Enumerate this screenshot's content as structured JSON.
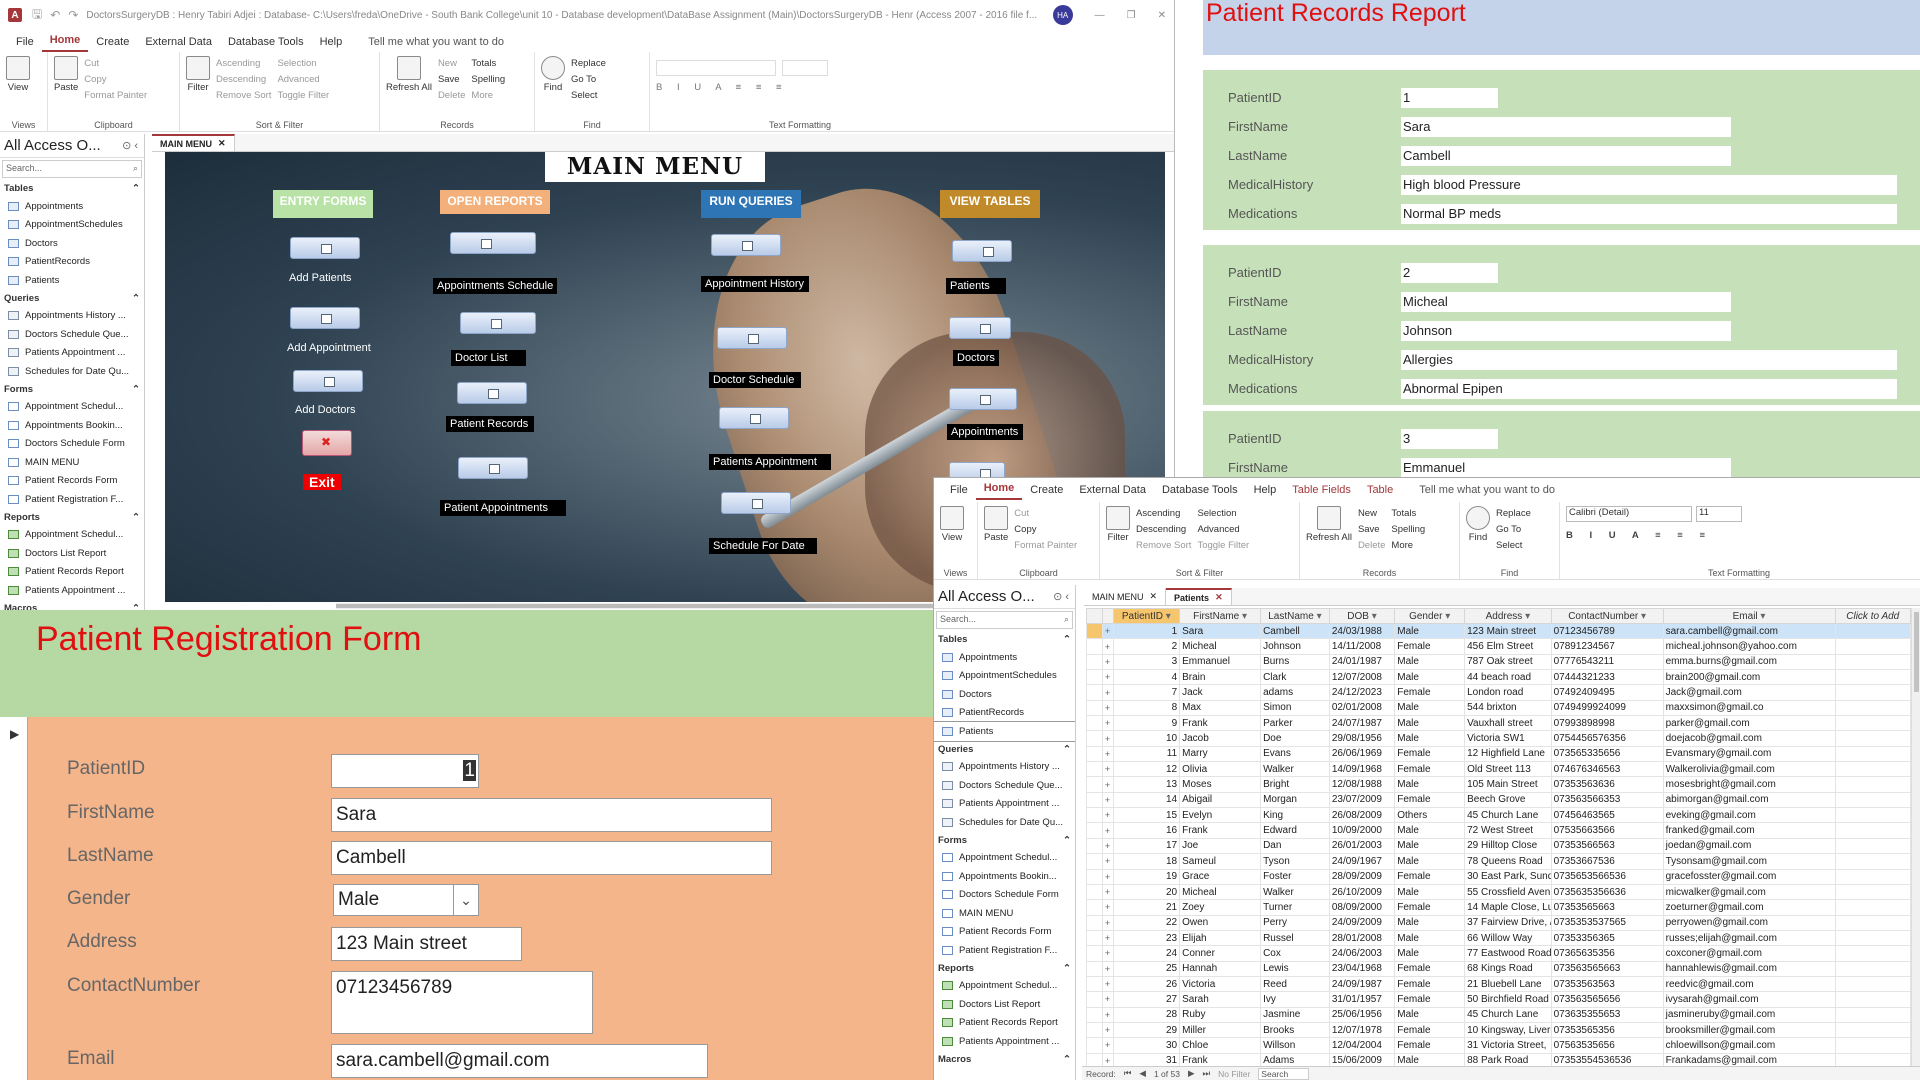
{
  "winA": {
    "title": "DoctorsSurgeryDB : Henry Tabiri Adjei : Database- C:\\Users\\freda\\OneDrive - South Bank College\\unit 10 - Database development\\DataBase Assignment (Main)\\DoctorsSurgeryDB - Henr (Access 2007 - 2016 file f...",
    "avatar": "HA",
    "menu": [
      "File",
      "Home",
      "Create",
      "External Data",
      "Database Tools",
      "Help"
    ],
    "tell_me": "Tell me what you want to do",
    "ribbon": {
      "view": "View",
      "paste": "Paste",
      "cut": "Cut",
      "copy": "Copy",
      "format_painter": "Format Painter",
      "filter": "Filter",
      "ascending": "Ascending",
      "descending": "Descending",
      "remove_sort": "Remove Sort",
      "selection": "Selection",
      "advanced": "Advanced",
      "toggle_filter": "Toggle Filter",
      "refresh": "Refresh All",
      "new": "New",
      "save": "Save",
      "delete": "Delete",
      "totals": "Totals",
      "spelling": "Spelling",
      "more": "More",
      "find": "Find",
      "replace": "Replace",
      "goto": "Go To",
      "select": "Select",
      "groups": [
        "Views",
        "Clipboard",
        "Sort & Filter",
        "Records",
        "Find",
        "Text Formatting"
      ]
    },
    "nav": {
      "header": "All Access O...",
      "search": "Search...",
      "sections": [
        {
          "name": "Tables",
          "type": "t",
          "items": [
            "Appointments",
            "AppointmentSchedules",
            "Doctors",
            "PatientRecords",
            "Patients"
          ]
        },
        {
          "name": "Queries",
          "type": "q",
          "items": [
            "Appointments History ...",
            "Doctors Schedule Que...",
            "Patients Appointment ...",
            "Schedules for Date Qu..."
          ]
        },
        {
          "name": "Forms",
          "type": "f",
          "items": [
            "Appointment Schedul...",
            "Appointments Bookin...",
            "Doctors Schedule Form",
            "MAIN MENU",
            "Patient Records Form",
            "Patient Registration F..."
          ]
        },
        {
          "name": "Reports",
          "type": "r",
          "items": [
            "Appointment Schedul...",
            "Doctors List Report",
            "Patient Records Report",
            "Patients Appointment ..."
          ]
        },
        {
          "name": "Macros",
          "type": "m",
          "items": []
        }
      ]
    },
    "doc_tab": "MAIN MENU",
    "main_menu": {
      "title": "MAIN MENU",
      "headers": {
        "entry": "ENTRY FORMS",
        "reports": "OPEN REPORTS",
        "queries": "RUN QUERIES",
        "tables": "VIEW TABLES"
      },
      "header_colors": {
        "entry": "#b9e2a6",
        "reports": "#f3b07a",
        "queries": "#2e75b6",
        "tables": "#c08a2b"
      },
      "entry_labels": [
        "Add Patients",
        "Add Appointment",
        "Add Doctors"
      ],
      "exit_label": "Exit",
      "report_labels": [
        "Appointments Schedule",
        "Doctor  List",
        "Patient Records",
        "Patient  Appointments"
      ],
      "query_labels": [
        "Appointment History",
        "Doctor Schedule",
        "Patients Appointment",
        "Schedule For Date"
      ],
      "table_labels": [
        "Patients",
        "Doctors",
        "Appointments"
      ]
    }
  },
  "report": {
    "title": "Patient Records Report",
    "field_labels": [
      "PatientID",
      "FirstName",
      "LastName",
      "MedicalHistory",
      "Medications"
    ],
    "records": [
      {
        "id": "1",
        "first": "Sara",
        "last": "Cambell",
        "history": "High blood Pressure",
        "meds": "Normal BP meds"
      },
      {
        "id": "2",
        "first": "Micheal",
        "last": "Johnson",
        "history": "Allergies",
        "meds": "Abnormal Epipen"
      },
      {
        "id": "3",
        "first": "Emmanuel",
        "last": "",
        "history": "",
        "meds": ""
      }
    ]
  },
  "regform": {
    "title": "Patient Registration Form",
    "labels": {
      "id": "PatientID",
      "first": "FirstName",
      "last": "LastName",
      "gender": "Gender",
      "address": "Address",
      "contact": "ContactNumber",
      "email": "Email"
    },
    "values": {
      "id": "1",
      "first": "Sara",
      "last": "Cambell",
      "gender": "Male",
      "address": "123 Main street",
      "contact": "07123456789",
      "email": "sara.cambell@gmail.com"
    }
  },
  "winB": {
    "menu": [
      "File",
      "Home",
      "Create",
      "External Data",
      "Database Tools",
      "Help",
      "Table Fields",
      "Table"
    ],
    "tell_me": "Tell me what you want to do",
    "font_name": "Calibri (Detail)",
    "font_size": "11",
    "tabs": [
      "MAIN MENU",
      "Patients"
    ],
    "nav_selected": "Patients",
    "columns": [
      "PatientID",
      "FirstName",
      "LastName",
      "DOB",
      "Gender",
      "Address",
      "ContactNumber",
      "Email",
      "Click to Add"
    ],
    "rows": [
      [
        "1",
        "Sara",
        "Cambell",
        "24/03/1988",
        "Male",
        "123 Main street",
        "07123456789",
        "sara.cambell@gmail.com"
      ],
      [
        "2",
        "Micheal",
        "Johnson",
        "14/11/2008",
        "Female",
        "456 Elm Street",
        "07891234567",
        "micheal.johnson@yahoo.com"
      ],
      [
        "3",
        "Emmanuel",
        "Burns",
        "24/01/1987",
        "Male",
        "787 Oak street",
        "07776543211",
        "emma.burns@gmail.com"
      ],
      [
        "4",
        "Brain",
        "Clark",
        "12/07/2008",
        "Male",
        "44 beach road",
        "07444321233",
        "brain200@gmail.com"
      ],
      [
        "7",
        "Jack",
        "adams",
        "24/12/2023",
        "Female",
        "London road",
        "07492409495",
        "Jack@gmail.com"
      ],
      [
        "8",
        "Max",
        "Simon",
        "02/01/2008",
        "Male",
        "544 brixton",
        "0749499924099",
        "maxxsimon@gmail.co"
      ],
      [
        "9",
        "Frank",
        "Parker",
        "24/07/1987",
        "Male",
        "Vauxhall street",
        "07993898998",
        "parker@gmail.com"
      ],
      [
        "10",
        "Jacob",
        "Doe",
        "29/08/1956",
        "Male",
        "Victoria SW1",
        "0754456576356",
        "doejacob@gmail.com"
      ],
      [
        "11",
        "Marry",
        "Evans",
        "26/06/1969",
        "Female",
        "12 Highfield Lane",
        "073565335656",
        "Evansmary@gmail.com"
      ],
      [
        "12",
        "Olivia",
        "Walker",
        "14/09/1968",
        "Female",
        "Old Street 113",
        "074676346563",
        "Walkerolivia@gmail.com"
      ],
      [
        "13",
        "Moses",
        "Bright",
        "12/08/1988",
        "Male",
        "105 Main Street",
        "07353563636",
        "mosesbright@gmail.com"
      ],
      [
        "14",
        "Abigail",
        "Morgan",
        "23/07/2009",
        "Female",
        "Beech Grove",
        "073563566353",
        "abimorgan@gmail.com"
      ],
      [
        "15",
        "Evelyn",
        "King",
        "26/08/2009",
        "Others",
        "45 Church Lane",
        "07456463565",
        "eveking@gmail.com"
      ],
      [
        "16",
        "Frank",
        "Edward",
        "10/09/2000",
        "Male",
        "72 West Street",
        "07535663566",
        "franked@gmail.com"
      ],
      [
        "17",
        "Joe",
        "Dan",
        "26/01/2003",
        "Male",
        "29 Hilltop Close",
        "07353566563",
        "joedan@gmail.com"
      ],
      [
        "18",
        "Sameul",
        "Tyson",
        "24/09/1967",
        "Male",
        "78 Queens Road",
        "07353667536",
        "Tysonsam@gmail.com"
      ],
      [
        "19",
        "Grace",
        "Foster",
        "28/09/2009",
        "Female",
        "30 East Park, Sunde",
        "0735653566536",
        "gracefosster@gmail.com"
      ],
      [
        "20",
        "Micheal",
        "Walker",
        "26/10/2009",
        "Male",
        "55 Crossfield Aven",
        "0735635356636",
        "micwalker@gmail.com"
      ],
      [
        "21",
        "Zoey",
        "Turner",
        "08/09/2000",
        "Female",
        "14 Maple Close, Lu",
        "07353565663",
        "zoeturner@gmail.com"
      ],
      [
        "22",
        "Owen",
        "Perry",
        "24/09/2009",
        "Male",
        "37 Fairview Drive, /",
        "0735353537565",
        "perryowen@gmail.com"
      ],
      [
        "23",
        "Elijah",
        "Russel",
        "28/01/2008",
        "Male",
        "66 Willow Way",
        "07353356365",
        "russes;elijah@gmail.com"
      ],
      [
        "24",
        "Conner",
        "Cox",
        "24/06/2003",
        "Male",
        "77 Eastwood Road",
        "07365635356",
        "coxconer@gmail.com"
      ],
      [
        "25",
        "Hannah",
        "Lewis",
        "23/04/1968",
        "Female",
        "68 Kings Road",
        "073563565663",
        "hannahlewis@gmail.com"
      ],
      [
        "26",
        "Victoria",
        "Reed",
        "24/09/1987",
        "Female",
        "21 Bluebell Lane",
        "07353563563",
        "reedvic@gmail.com"
      ],
      [
        "27",
        "Sarah",
        "Ivy",
        "31/01/1957",
        "Female",
        "50 Birchfield Road",
        "073563565656",
        "ivysarah@gmail.com"
      ],
      [
        "28",
        "Ruby",
        "Jasmine",
        "25/06/1956",
        "Male",
        "45 Church Lane",
        "073635355653",
        "jasmineruby@gmail.com"
      ],
      [
        "29",
        "Miller",
        "Brooks",
        "12/07/1978",
        "Female",
        "10 Kingsway, Liverr",
        "07353565356",
        "brooksmiller@gmail.com"
      ],
      [
        "30",
        "Chloe",
        "Willson",
        "12/04/2004",
        "Female",
        "31 Victoria Street,",
        "07563535656",
        "chloewillson@gmail.com"
      ],
      [
        "31",
        "Frank",
        "Adams",
        "15/06/2009",
        "Male",
        "88 Park Road",
        "07353554536536",
        "Frankadams@gmail.com"
      ]
    ],
    "record_label": "Record:",
    "record_pos": "1 of 53",
    "no_filter": "No Filter",
    "search": "Search"
  }
}
